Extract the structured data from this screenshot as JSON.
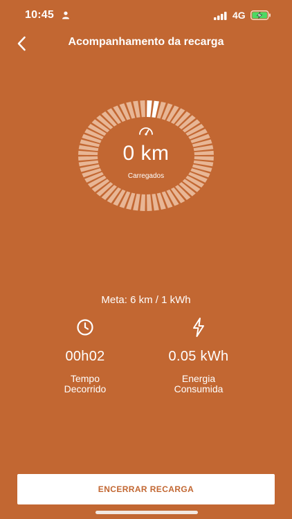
{
  "status_bar": {
    "time": "10:45",
    "network": "4G",
    "icons": [
      "person-icon",
      "signal-icon",
      "battery-charging-icon"
    ]
  },
  "nav": {
    "title": "Acompanhamento da recarga",
    "back_icon": "chevron-left-icon"
  },
  "gauge": {
    "value": "0 km",
    "caption": "Carregados",
    "icon": "speedometer-icon",
    "progress_fraction": 0.03
  },
  "meta": "Meta: 6 km / 1 kWh",
  "stats": {
    "time": {
      "icon": "clock-icon",
      "value": "00h02",
      "label_line1": "Tempo",
      "label_line2": "Decorrido"
    },
    "energy": {
      "icon": "lightning-icon",
      "value": "0.05 kWh",
      "label_line1": "Energia",
      "label_line2": "Consumida"
    }
  },
  "end_button_label": "ENCERRAR RECARGA",
  "colors": {
    "background": "#C26732",
    "segment_inactive": "#E8B695",
    "segment_active": "#FFFFFF",
    "text": "#FFFFFF"
  }
}
